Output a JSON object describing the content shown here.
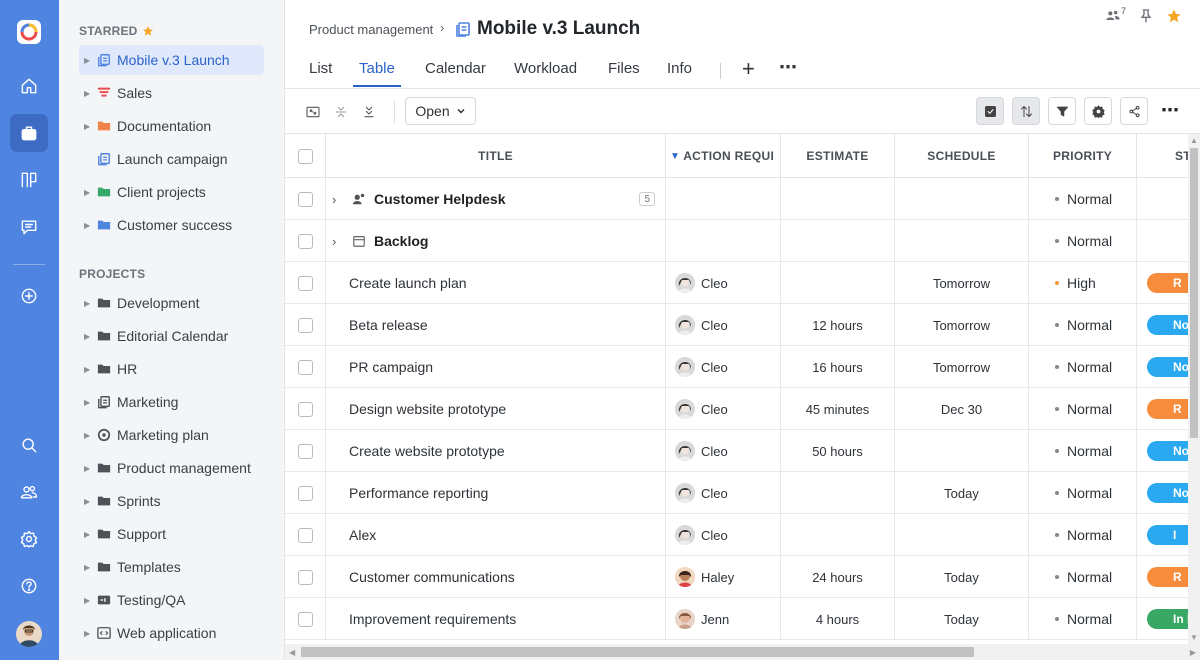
{
  "rail": {
    "items": [
      "home-icon",
      "briefcase-icon",
      "board-icon",
      "chat-icon",
      "add-icon",
      "search-icon",
      "users-icon",
      "settings-icon",
      "help-icon"
    ]
  },
  "sidebar": {
    "starred_heading": "STARRED",
    "starred": [
      {
        "label": "Mobile v.3 Launch",
        "icon": "project-icon",
        "color": "#4f84e0",
        "caret": true,
        "selected": true
      },
      {
        "label": "Sales",
        "icon": "funnel-icon",
        "color": "#e84c4c",
        "caret": true
      },
      {
        "label": "Documentation",
        "icon": "folder-icon",
        "color": "#f0834a",
        "caret": true
      },
      {
        "label": "Launch campaign",
        "icon": "project-icon",
        "color": "#4f84e0",
        "caret": false
      },
      {
        "label": "Client projects",
        "icon": "folder-icon",
        "color": "#39a86b",
        "caret": true
      },
      {
        "label": "Customer success",
        "icon": "folder-icon",
        "color": "#4f84e0",
        "caret": true
      }
    ],
    "projects_heading": "PROJECTS",
    "projects": [
      {
        "label": "Development",
        "icon": "folder-icon"
      },
      {
        "label": "Editorial Calendar",
        "icon": "folder-icon"
      },
      {
        "label": "HR",
        "icon": "folder-icon"
      },
      {
        "label": "Marketing",
        "icon": "project-icon"
      },
      {
        "label": "Marketing plan",
        "icon": "target-icon"
      },
      {
        "label": "Product management",
        "icon": "folder-icon"
      },
      {
        "label": "Sprints",
        "icon": "folder-icon"
      },
      {
        "label": "Support",
        "icon": "folder-icon"
      },
      {
        "label": "Templates",
        "icon": "folder-icon"
      },
      {
        "label": "Testing/QA",
        "icon": "qa-icon"
      },
      {
        "label": "Web application",
        "icon": "code-icon"
      }
    ]
  },
  "header": {
    "breadcrumb": "Product management",
    "title": "Mobile v.3 Launch",
    "members_count": "7",
    "tabs": [
      "List",
      "Table",
      "Calendar",
      "Workload",
      "Files",
      "Info"
    ],
    "active_tab": "Table"
  },
  "toolbar": {
    "filter_value": "Open"
  },
  "table": {
    "columns": [
      "TITLE",
      "ACTION REQUI",
      "ESTIMATE",
      "SCHEDULE",
      "PRIORITY",
      "ST"
    ],
    "groups": [
      {
        "title": "Customer Helpdesk",
        "count": "5",
        "priority": "Normal"
      },
      {
        "title": "Backlog",
        "priority": "Normal"
      }
    ],
    "rows": [
      {
        "title": "Create launch plan",
        "assignee": "Cleo",
        "estimate": "",
        "schedule": "Tomorrow",
        "priority": "High",
        "status": "R",
        "status_color": "#f78c3c"
      },
      {
        "title": "Beta release",
        "assignee": "Cleo",
        "estimate": "12 hours",
        "schedule": "Tomorrow",
        "priority": "Normal",
        "status": "Not",
        "status_color": "#2aa9f0"
      },
      {
        "title": "PR campaign",
        "assignee": "Cleo",
        "estimate": "16 hours",
        "schedule": "Tomorrow",
        "priority": "Normal",
        "status": "Not",
        "status_color": "#2aa9f0"
      },
      {
        "title": "Design website prototype",
        "assignee": "Cleo",
        "estimate": "45 minutes",
        "schedule": "Dec 30",
        "priority": "Normal",
        "status": "R",
        "status_color": "#f78c3c"
      },
      {
        "title": "Create website prototype",
        "assignee": "Cleo",
        "estimate": "50 hours",
        "schedule": "",
        "priority": "Normal",
        "status": "Not",
        "status_color": "#2aa9f0"
      },
      {
        "title": "Performance reporting",
        "assignee": "Cleo",
        "estimate": "",
        "schedule": "Today",
        "priority": "Normal",
        "status": "Not",
        "status_color": "#2aa9f0"
      },
      {
        "title": "Alex",
        "assignee": "Cleo",
        "estimate": "",
        "schedule": "",
        "priority": "Normal",
        "status": "I",
        "status_color": "#2aa9f0"
      },
      {
        "title": "Customer communications",
        "assignee": "Haley",
        "estimate": "24 hours",
        "schedule": "Today",
        "priority": "Normal",
        "status": "R",
        "status_color": "#f78c3c"
      },
      {
        "title": "Improvement requirements",
        "assignee": "Jenn",
        "estimate": "4 hours",
        "schedule": "Today",
        "priority": "Normal",
        "status": "In P",
        "status_color": "#3aa865"
      }
    ]
  }
}
